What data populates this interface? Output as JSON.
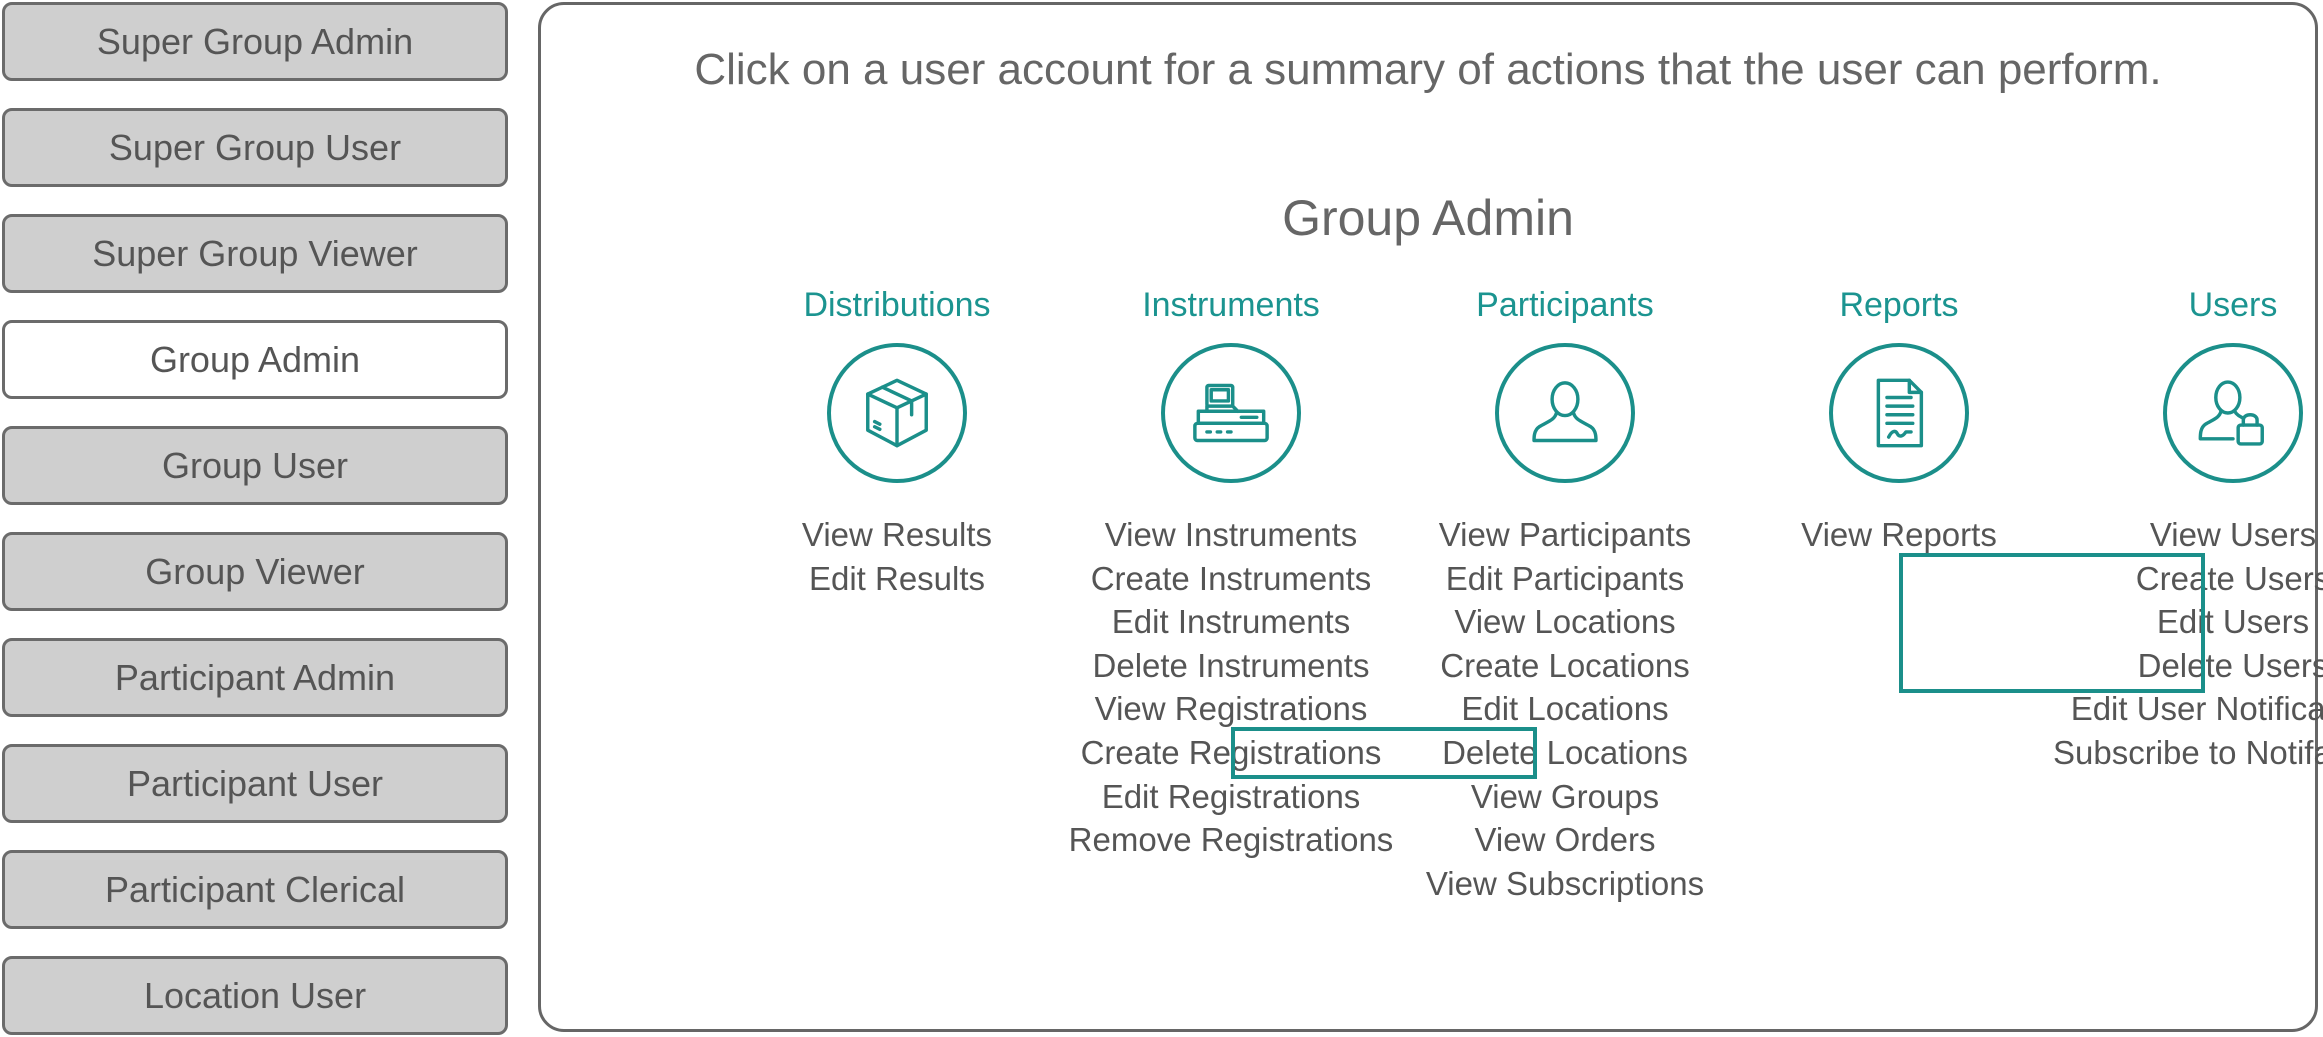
{
  "sidebar": {
    "roles": [
      {
        "label": "Super Group Admin",
        "active": false
      },
      {
        "label": "Super Group User",
        "active": false
      },
      {
        "label": "Super Group Viewer",
        "active": false
      },
      {
        "label": "Group Admin",
        "active": true
      },
      {
        "label": "Group User",
        "active": false
      },
      {
        "label": "Group Viewer",
        "active": false
      },
      {
        "label": "Participant Admin",
        "active": false
      },
      {
        "label": "Participant User",
        "active": false
      },
      {
        "label": "Participant Clerical",
        "active": false
      },
      {
        "label": "Location User",
        "active": false
      }
    ]
  },
  "main": {
    "instruction": "Click on a user account for a summary of actions that the user can perform.",
    "role_title": "Group Admin",
    "accent_color": "#1b8f8a",
    "categories": [
      {
        "label": "Distributions",
        "icon": "package-icon",
        "actions": [
          "View Results",
          "Edit Results"
        ]
      },
      {
        "label": "Instruments",
        "icon": "instrument-icon",
        "actions": [
          "View Instruments",
          "Create Instruments",
          "Edit Instruments",
          "Delete Instruments",
          "View Registrations",
          "Create Registrations",
          "Edit Registrations",
          "Remove Registrations"
        ]
      },
      {
        "label": "Participants",
        "icon": "person-icon",
        "actions": [
          "View Participants",
          "Edit Participants",
          "View Locations",
          "Create Locations",
          "Edit Locations",
          "Delete Locations",
          "View Groups",
          "View Orders",
          "View Subscriptions"
        ]
      },
      {
        "label": "Reports",
        "icon": "report-icon",
        "actions": [
          "View Reports"
        ]
      },
      {
        "label": "Users",
        "icon": "user-lock-icon",
        "actions": [
          "View Users",
          "Create Users",
          "Edit Users",
          "Delete Users",
          "Edit User Notifications",
          "Subscribe to Notifactions"
        ]
      }
    ],
    "highlights": [
      "Delete Locations",
      "Create Users",
      "Edit Users",
      "Delete Users"
    ]
  }
}
